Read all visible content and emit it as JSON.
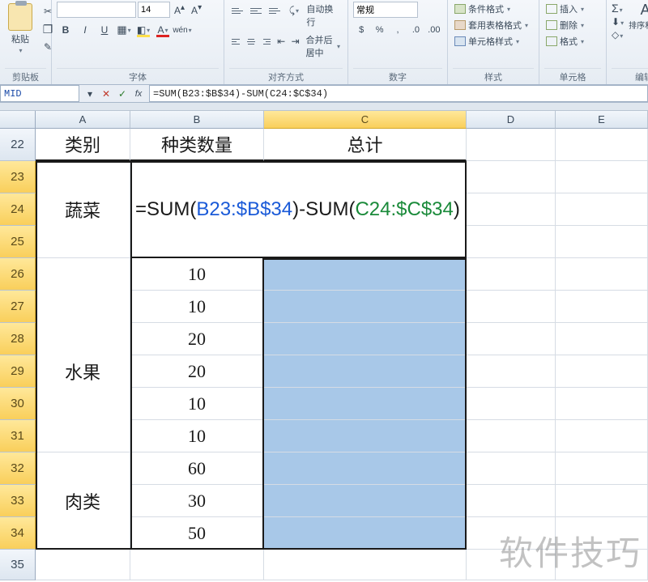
{
  "ribbon": {
    "clipboard": {
      "paste": "粘贴",
      "label": "剪贴板"
    },
    "font": {
      "font_name": "",
      "size": "14",
      "label": "字体",
      "bold": "B",
      "italic": "I",
      "underline": "U",
      "fontcolor_letter": "A"
    },
    "align": {
      "label": "对齐方式",
      "wrap": "自动换行",
      "merge": "合并后居中"
    },
    "number": {
      "format": "常规",
      "label": "数字",
      "currency": "$",
      "percent": "%",
      "comma": ",",
      "dec_inc": ".0",
      "dec_dec": ".00"
    },
    "styles": {
      "cond": "条件格式",
      "table": "套用表格格式",
      "cell": "单元格样式",
      "label": "样式"
    },
    "cells": {
      "insert": "插入",
      "delete": "删除",
      "format": "格式",
      "label": "单元格"
    },
    "editing": {
      "sigma": "Σ",
      "fill": "⬇",
      "clear": "◇",
      "sort": "排序和筛选",
      "label": "编辑"
    }
  },
  "namebox": "MID",
  "formula": "=SUM(B23:$B$34)-SUM(C24:$C$34)",
  "cols": [
    "A",
    "B",
    "C",
    "D",
    "E"
  ],
  "rows": [
    "22",
    "23",
    "24",
    "25",
    "26",
    "27",
    "28",
    "29",
    "30",
    "31",
    "32",
    "33",
    "34",
    "35"
  ],
  "header_row": {
    "A": "类别",
    "B": "种类数量",
    "C": "总计"
  },
  "colA": {
    "r24": "蔬菜",
    "r29": "水果",
    "r33": "肉类"
  },
  "colB": {
    "r26": "10",
    "r27": "10",
    "r28": "20",
    "r29": "20",
    "r30": "10",
    "r31": "10",
    "r32": "60",
    "r33": "30",
    "r34": "50"
  },
  "edit_formula": {
    "p1": "=SUM(",
    "p2": "B23:$B$34",
    "p3": ")-SUM(",
    "p4": "C24:$C$34",
    "p5": ")"
  },
  "watermark": "软件技巧"
}
